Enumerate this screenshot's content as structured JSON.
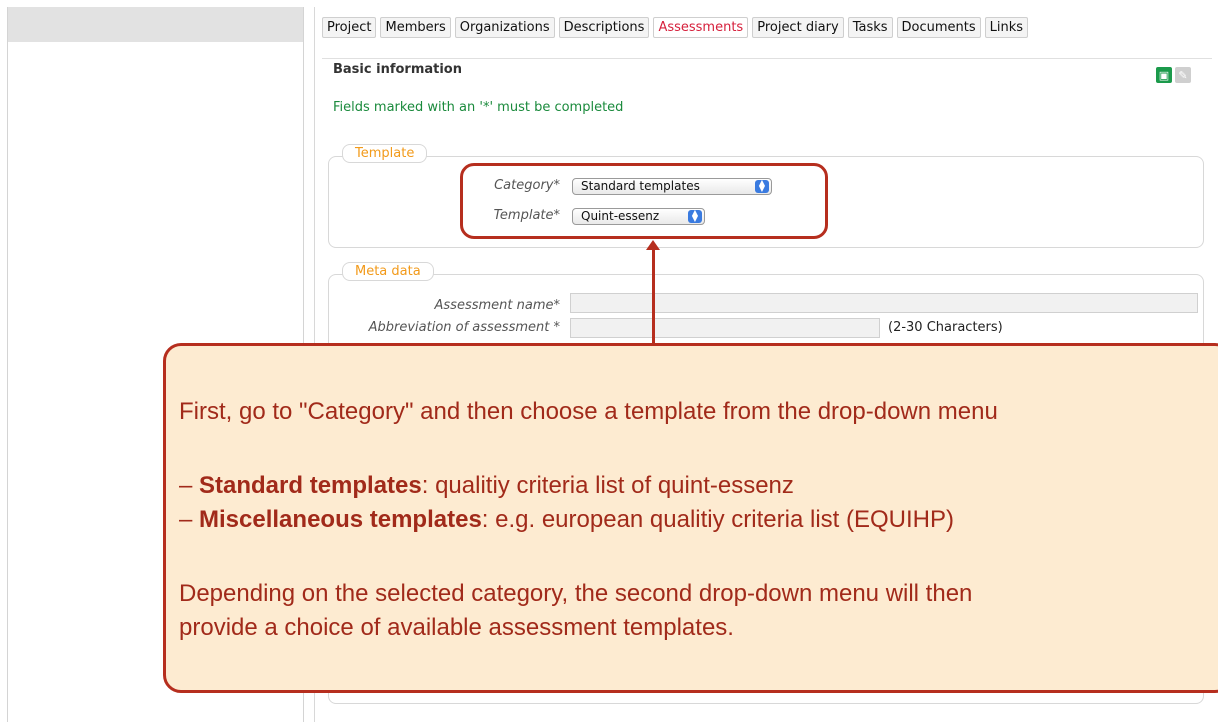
{
  "tabs": [
    "Project",
    "Members",
    "Organizations",
    "Descriptions",
    "Assessments",
    "Project diary",
    "Tasks",
    "Documents",
    "Links"
  ],
  "active_tab": "Assessments",
  "basic": {
    "title": "Basic information",
    "required_note": "Fields marked with an '*' must be completed",
    "save_icon": "save-icon",
    "edit_icon": "edit-icon"
  },
  "template_section": {
    "legend": "Template",
    "category_label": "Category*",
    "category_value": "Standard templates",
    "template_label": "Template*",
    "template_value": "Quint-essenz"
  },
  "meta_section": {
    "legend": "Meta data",
    "assessment_name_label": "Assessment name*",
    "abbreviation_label": "Abbreviation of assessment *",
    "abbreviation_hint": "(2-30 Characters)"
  },
  "callout": {
    "line1": "First, go to \"Category\" and then choose a template from the drop-down menu",
    "item1_bold": "Standard templates",
    "item1_rest": ": qualitiy criteria list of quint-essenz",
    "item2_bold": "Miscellaneous templates",
    "item2_rest": ": e.g. european qualitiy criteria list (EQUIHP)",
    "line4": "Depending on the selected category, the second drop-down menu will then",
    "line5": "provide a choice of available assessment templates.",
    "dash": "– "
  },
  "colors": {
    "accent_red": "#b62e1e",
    "callout_bg": "#fdebd1",
    "active_tab": "#d6203c",
    "legend_orange": "#f29a1a",
    "note_green": "#1a8a3c"
  }
}
